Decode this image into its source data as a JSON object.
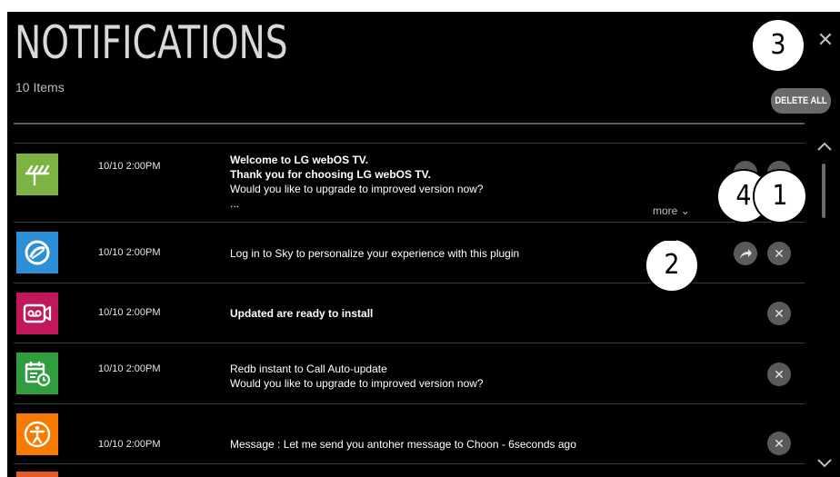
{
  "header": {
    "title": "NOTIFICATIONS",
    "item_count": "10 Items",
    "delete_all_label": "DELETE ALL",
    "close_glyph": "✕"
  },
  "notifications": [
    {
      "time": "10/10 2:00PM",
      "lines": [
        "Welcome to LG webOS TV.",
        "Thank you for choosing LG webOS TV.",
        "Would you like to upgrade to improved version now?",
        "..."
      ],
      "icon": "antenna-icon",
      "icon_color": "#7cb342",
      "more_label": "more"
    },
    {
      "time": "10/10 2:00PM",
      "lines": [
        "Log in to Sky to personalize your experience with this plugin"
      ],
      "icon": "sky-icon",
      "icon_color": "#2d8fd5"
    },
    {
      "time": "10/10 2:00PM",
      "lines": [
        "Updated are ready to install"
      ],
      "icon": "voicemail-icon",
      "icon_color": "#c2185b"
    },
    {
      "time": "10/10 2:00PM",
      "lines": [
        "Redb instant to Call Auto-update",
        "Would you like to upgrade to improved version now?"
      ],
      "icon": "calendar-icon",
      "icon_color": "#2e9e3e"
    },
    {
      "time": "10/10 2:00PM",
      "lines": [
        "Message : Let me send you antoher message to Choon - 6seconds ago"
      ],
      "icon": "accessibility-icon",
      "icon_color": "#f57c00"
    }
  ],
  "callouts": [
    "1",
    "2",
    "3",
    "4"
  ],
  "colors": {
    "background": "#000000",
    "button_gray": "#5a5a5a",
    "text_primary": "#ffffff",
    "text_secondary": "#bdbdbd",
    "partial_row_color": "#e05a2a"
  }
}
